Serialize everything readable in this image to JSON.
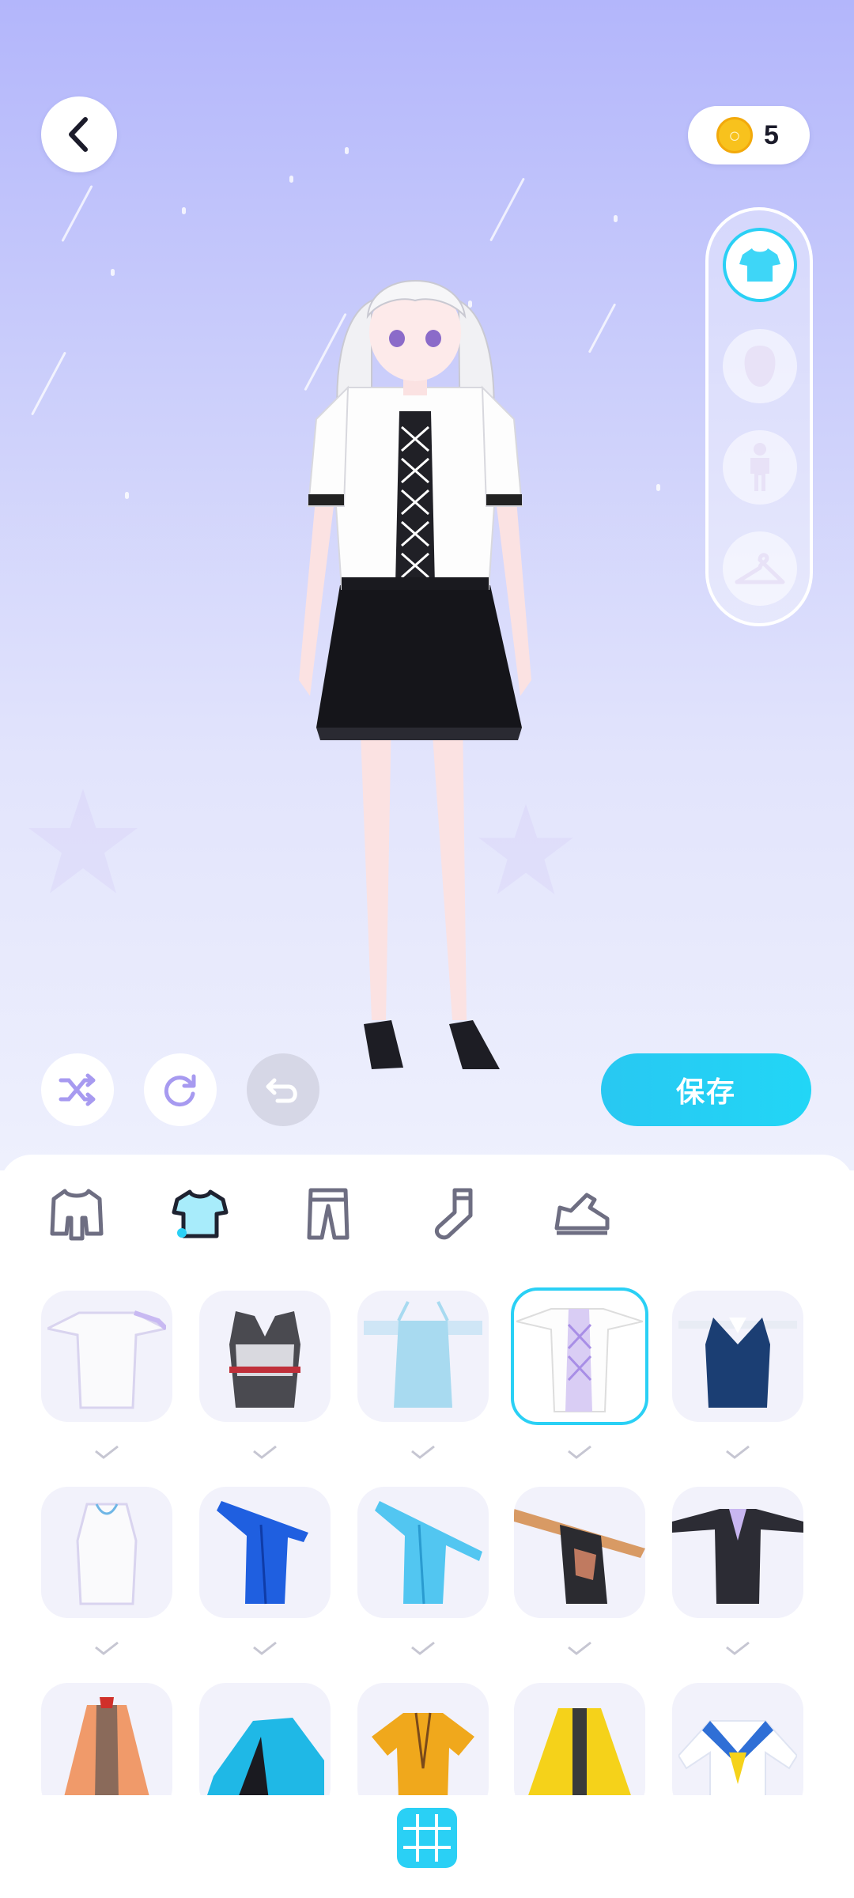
{
  "header": {
    "back_icon": "chevron-left-icon",
    "coins": "5"
  },
  "side_categories": [
    {
      "name": "clothing",
      "icon": "tshirt-icon",
      "active": true
    },
    {
      "name": "face",
      "icon": "head-icon",
      "active": false
    },
    {
      "name": "body",
      "icon": "person-icon",
      "active": false
    },
    {
      "name": "outfits",
      "icon": "hanger-icon",
      "active": false
    }
  ],
  "actions": {
    "shuffle_icon": "shuffle-icon",
    "reset_icon": "refresh-icon",
    "undo_icon": "undo-icon",
    "save_label": "保存"
  },
  "clothing_tabs": [
    {
      "name": "full-outfit",
      "icon": "outfit-icon",
      "active": false
    },
    {
      "name": "tops",
      "icon": "tshirt-icon",
      "active": true
    },
    {
      "name": "pants",
      "icon": "pants-icon",
      "active": false
    },
    {
      "name": "socks",
      "icon": "sock-icon",
      "active": false
    },
    {
      "name": "shoes",
      "icon": "sneaker-icon",
      "active": false
    }
  ],
  "colors": {
    "accent": "#2ad0f5",
    "stage_top": "#b3b6fb",
    "stage_bottom": "#eef0fd"
  },
  "grid_icon": "grid-icon"
}
